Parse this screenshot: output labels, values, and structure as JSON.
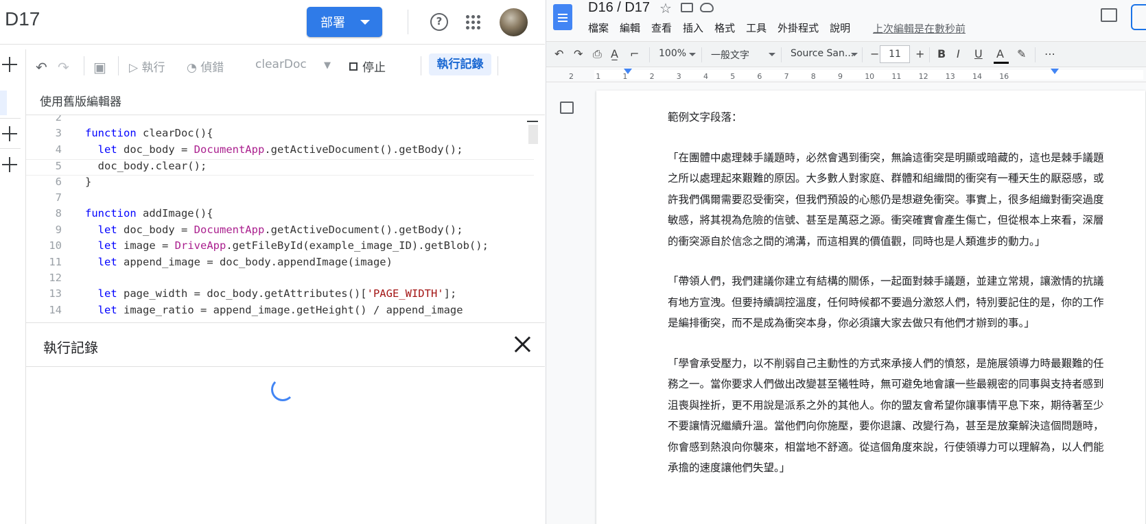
{
  "apps_script": {
    "title": "D17",
    "deploy_label": "部署",
    "help_label": "?",
    "toolbar": {
      "run_label": "執行",
      "debug_label": "偵錯",
      "function_name": "clearDoc",
      "stop_label": "停止",
      "log_label": "執行記錄"
    },
    "legacy_editor_label": "使用舊版編輯器",
    "code_lines": [
      {
        "n": "2",
        "t": ""
      },
      {
        "n": "3",
        "t": "function clearDoc(){"
      },
      {
        "n": "4",
        "t": "  let doc_body = DocumentApp.getActiveDocument().getBody();"
      },
      {
        "n": "5",
        "t": "  doc_body.clear();"
      },
      {
        "n": "6",
        "t": "}"
      },
      {
        "n": "7",
        "t": ""
      },
      {
        "n": "8",
        "t": "function addImage(){"
      },
      {
        "n": "9",
        "t": "  let doc_body = DocumentApp.getActiveDocument().getBody();"
      },
      {
        "n": "10",
        "t": "  let image = DriveApp.getFileById(example_image_ID).getBlob();"
      },
      {
        "n": "11",
        "t": "  let append_image = doc_body.appendImage(image)"
      },
      {
        "n": "12",
        "t": ""
      },
      {
        "n": "13",
        "t": "  let page_width = doc_body.getAttributes()['PAGE_WIDTH'];"
      },
      {
        "n": "14",
        "t": "  let image_ratio = append_image.getHeight() / append_image"
      }
    ],
    "log_panel": {
      "title": "執行記錄"
    }
  },
  "docs": {
    "title": "D16 / D17",
    "menu": [
      "檔案",
      "編輯",
      "查看",
      "插入",
      "格式",
      "工具",
      "外掛程式",
      "說明"
    ],
    "last_edit": "上次編輯是在數秒前",
    "toolbar": {
      "zoom": "100%",
      "style": "一般文字",
      "font": "Source San...",
      "font_size": "11"
    },
    "ruler_numbers": [
      "2",
      "1",
      "1",
      "2",
      "3",
      "4",
      "5",
      "6",
      "7",
      "8",
      "9",
      "10",
      "11",
      "12",
      "13",
      "14",
      "16"
    ],
    "body": {
      "heading": "範例文字段落：",
      "paragraphs": [
        "「在團體中處理棘手議題時，必然會遇到衝突，無論這衝突是明顯或暗藏的，這也是棘手議題之所以處理起來艱難的原因。大多數人對家庭、群體和組織間的衝突有一種天生的厭惡感，或許我們偶爾需要忍受衝突，但我們預設的心態仍是想避免衝突。事實上，很多組織對衝突過度敏感，將其視為危險的信號、甚至是萬惡之源。衝突確實會產生傷亡，但從根本上來看，深層的衝突源自於信念之間的鴻溝，而這相異的價值觀，同時也是人類進步的動力。」",
        "「帶領人們，我們建議你建立有結構的關係，一起面對棘手議題，並建立常規，讓激情的抗議有地方宣洩。但要持續調控溫度，任何時候都不要過分激怒人們，特別要記住的是，你的工作是編排衝突，而不是成為衝突本身，你必須讓大家去做只有他們才辦到的事。」",
        "「學會承受壓力，以不削弱自己主動性的方式來承接人們的憤怒，是施展領導力時最艱難的任務之一。當你要求人們做出改變甚至犧牲時，無可避免地會讓一些最親密的同事與支持者感到沮喪與挫折，更不用說是派系之外的其他人。你的盟友會希望你讓事情平息下來，期待著至少不要讓情況繼續升溫。當他們向你施壓，要你退讓、改變行為，甚至是放棄解決這個問題時，你會感到熱浪向你襲來，相當地不舒適。從這個角度來說，行使領導力可以理解為，以人們能承擔的速度讓他們失望。」"
      ]
    }
  }
}
